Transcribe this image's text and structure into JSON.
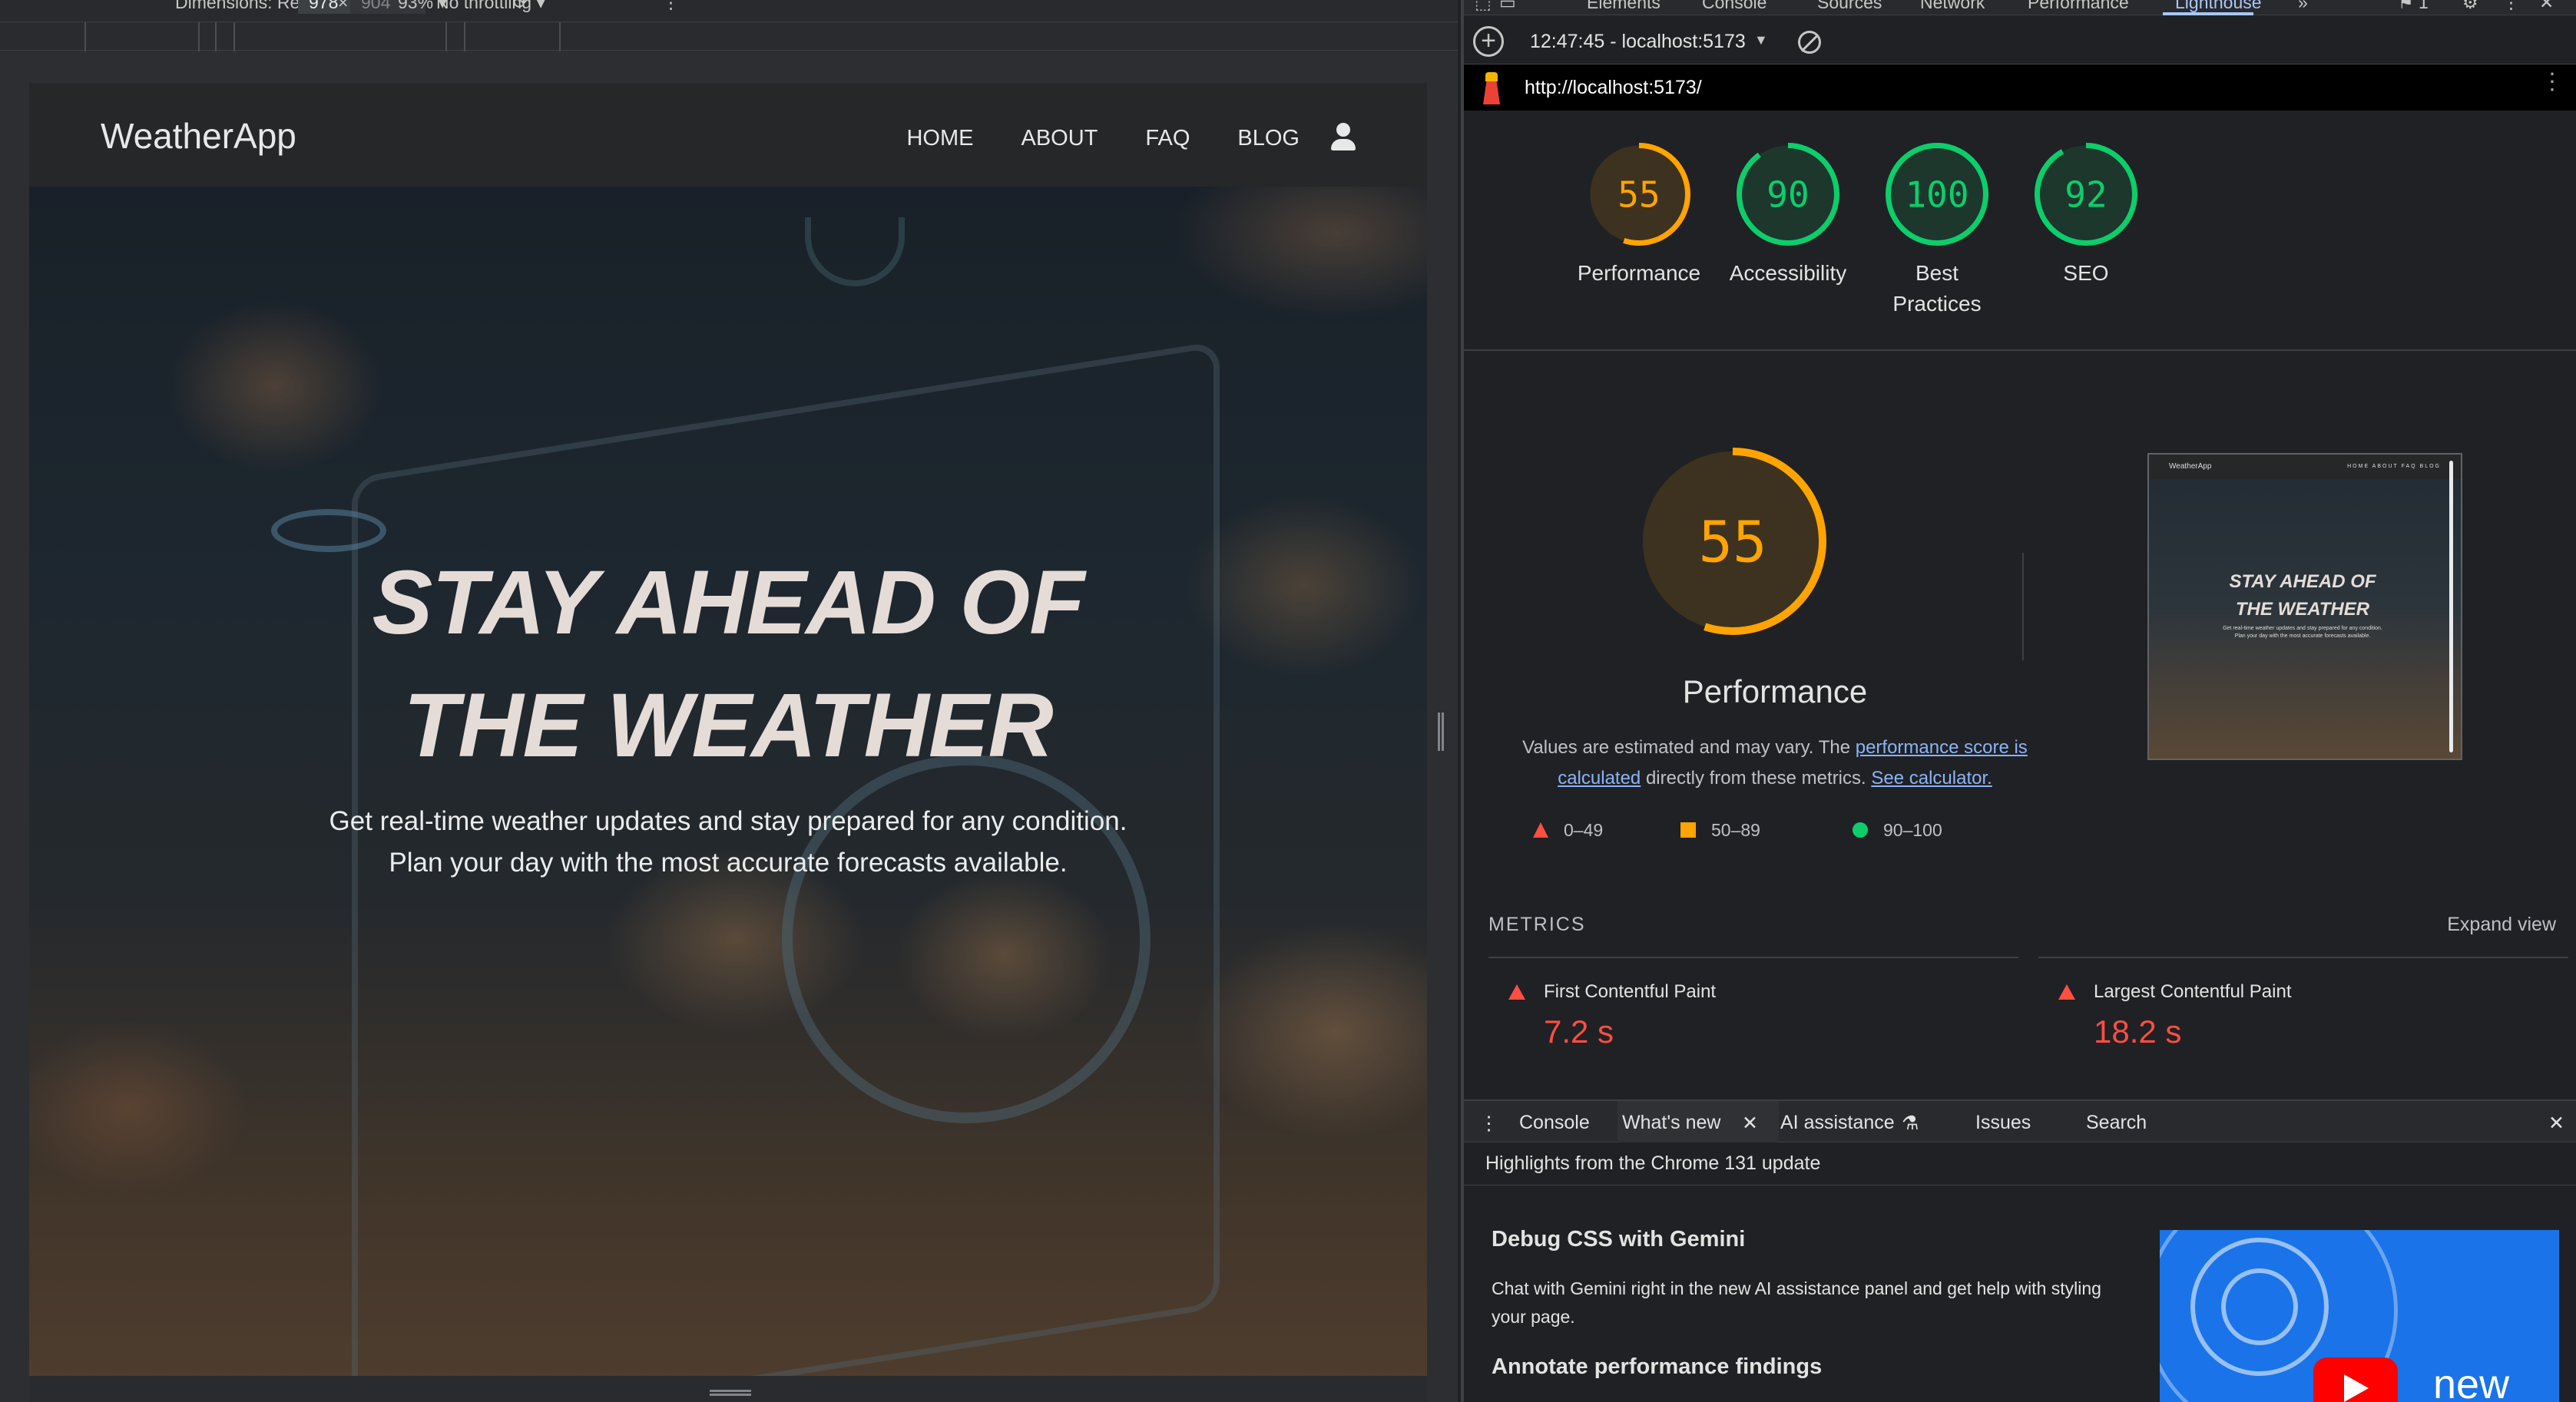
{
  "device_toolbar": {
    "dimensions_label": "Dimensions: Responsive ▾",
    "width": "978",
    "times": "×",
    "height": "904",
    "zoom": "93% ▾",
    "throttling": "No throttling ▾"
  },
  "site": {
    "brand": "WeatherApp",
    "nav": [
      "HOME",
      "ABOUT",
      "FAQ",
      "BLOG"
    ],
    "hero_title_line1": "STAY AHEAD OF",
    "hero_title_line2": "THE WEATHER",
    "hero_sub_line1": "Get real-time weather updates and stay prepared for any condition.",
    "hero_sub_line2": "Plan your day with the most accurate forecasts available."
  },
  "devtools": {
    "tabs": [
      "Elements",
      "Console",
      "Sources",
      "Network",
      "Performance",
      "Lighthouse"
    ],
    "active_tab": "Lighthouse",
    "issues_count": "1",
    "report_time": "12:47:45 - localhost:5173",
    "url": "http://localhost:5173/",
    "scores": [
      {
        "label": "Performance",
        "value": 55,
        "color": "#ffa400"
      },
      {
        "label": "Accessibility",
        "value": 90,
        "color": "#0cce6b"
      },
      {
        "label": "Best Practices",
        "value": 100,
        "color": "#0cce6b"
      },
      {
        "label": "SEO",
        "value": 92,
        "color": "#0cce6b"
      }
    ],
    "perf": {
      "score": 55,
      "title": "Performance",
      "desc_pre": "Values are estimated and may vary. The ",
      "desc_link1": "performance score is calculated",
      "desc_mid": " directly from these metrics. ",
      "desc_link2": "See calculator."
    },
    "legend": [
      {
        "range": "0–49",
        "color": "#ff4e42"
      },
      {
        "range": "50–89",
        "color": "#ffa400"
      },
      {
        "range": "90–100",
        "color": "#0cce6b"
      }
    ],
    "thumb": {
      "brand": "WeatherApp",
      "menu": "HOME ABOUT FAQ BLOG",
      "title_line1": "STAY AHEAD OF",
      "title_line2": "THE WEATHER",
      "sub_line1": "Get real-time weather updates and stay prepared for any condition.",
      "sub_line2": "Plan your day with the most accurate forecasts available."
    },
    "metrics_heading": "METRICS",
    "expand_view": "Expand view",
    "metrics": [
      {
        "name": "First Contentful Paint",
        "value": "7.2 s"
      },
      {
        "name": "Largest Contentful Paint",
        "value": "18.2 s"
      }
    ],
    "drawer": {
      "tabs": [
        "Console",
        "What's new",
        "AI assistance",
        "Issues",
        "Search"
      ],
      "active": "What's new",
      "highlights": "Highlights from the Chrome 131 update",
      "h1": "Debug CSS with Gemini",
      "p": "Chat with Gemini right in the new AI assistance panel and get help with styling your page.",
      "h2": "Annotate performance findings",
      "video_text": "new"
    }
  }
}
